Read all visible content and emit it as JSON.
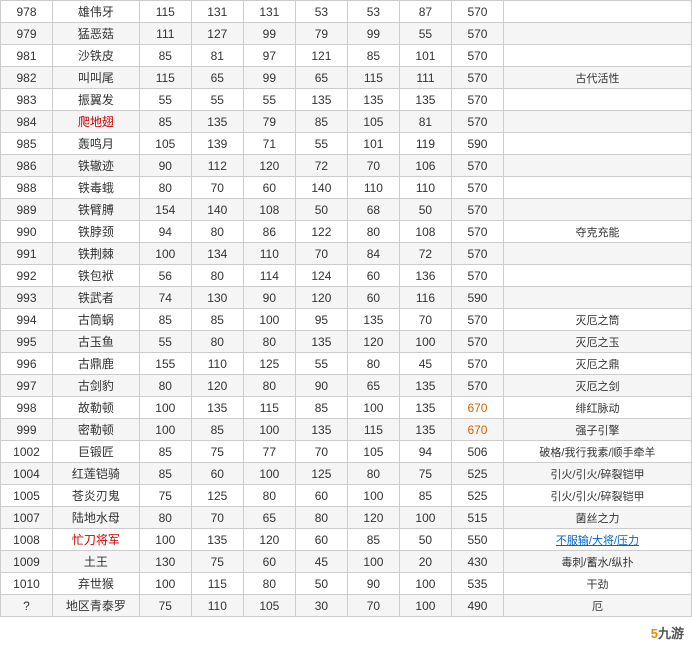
{
  "table": {
    "rows": [
      {
        "id": "978",
        "name": "雄伟牙",
        "s1": 115,
        "s2": 131,
        "s3": 131,
        "s4": 53,
        "s5": 53,
        "s6": 87,
        "total": 570,
        "special": ""
      },
      {
        "id": "979",
        "name": "猛恶菇",
        "s1": 111,
        "s2": 127,
        "s3": 99,
        "s4": 79,
        "s5": 99,
        "s6": 55,
        "total": 570,
        "special": ""
      },
      {
        "id": "981",
        "name": "沙铁皮",
        "s1": 85,
        "s2": 81,
        "s3": 97,
        "s4": 121,
        "s5": 85,
        "s6": 101,
        "total": 570,
        "special": ""
      },
      {
        "id": "982",
        "name": "叫叫尾",
        "s1": 115,
        "s2": 65,
        "s3": 99,
        "s4": 65,
        "s5": 115,
        "s6": 111,
        "total": 570,
        "special": "古代活性"
      },
      {
        "id": "983",
        "name": "振翼发",
        "s1": 55,
        "s2": 55,
        "s3": 55,
        "s4": 135,
        "s5": 135,
        "s6": 135,
        "total": 570,
        "special": ""
      },
      {
        "id": "984",
        "name": "爬地翅",
        "s1": 85,
        "s2": 135,
        "s3": 79,
        "s4": 85,
        "s5": 105,
        "s6": 81,
        "total": 570,
        "special": ""
      },
      {
        "id": "985",
        "name": "轰鸣月",
        "s1": 105,
        "s2": 139,
        "s3": 71,
        "s4": 55,
        "s5": 101,
        "s6": 119,
        "total": 590,
        "special": ""
      },
      {
        "id": "986",
        "name": "铁辙迹",
        "s1": 90,
        "s2": 112,
        "s3": 120,
        "s4": 72,
        "s5": 70,
        "s6": 106,
        "total": 570,
        "special": ""
      },
      {
        "id": "988",
        "name": "铁毒蛾",
        "s1": 80,
        "s2": 70,
        "s3": 60,
        "s4": 140,
        "s5": 110,
        "s6": 110,
        "total": 570,
        "special": ""
      },
      {
        "id": "989",
        "name": "铁臂膊",
        "s1": 154,
        "s2": 140,
        "s3": 108,
        "s4": 50,
        "s5": 68,
        "s6": 50,
        "total": 570,
        "special": ""
      },
      {
        "id": "990",
        "name": "铁脖颈",
        "s1": 94,
        "s2": 80,
        "s3": 86,
        "s4": 122,
        "s5": 80,
        "s6": 108,
        "total": 570,
        "special": "夺克充能"
      },
      {
        "id": "991",
        "name": "铁荆棘",
        "s1": 100,
        "s2": 134,
        "s3": 110,
        "s4": 70,
        "s5": 84,
        "s6": 72,
        "total": 570,
        "special": ""
      },
      {
        "id": "992",
        "name": "铁包袱",
        "s1": 56,
        "s2": 80,
        "s3": 114,
        "s4": 124,
        "s5": 60,
        "s6": 136,
        "total": 570,
        "special": ""
      },
      {
        "id": "993",
        "name": "铁武者",
        "s1": 74,
        "s2": 130,
        "s3": 90,
        "s4": 120,
        "s5": 60,
        "s6": 116,
        "total": 590,
        "special": ""
      },
      {
        "id": "994",
        "name": "古筒蜗",
        "s1": 85,
        "s2": 85,
        "s3": 100,
        "s4": 95,
        "s5": 135,
        "s6": 70,
        "total": 570,
        "special": "灭厄之筒"
      },
      {
        "id": "995",
        "name": "古玉鱼",
        "s1": 55,
        "s2": 80,
        "s3": 80,
        "s4": 135,
        "s5": 120,
        "s6": 100,
        "total": 570,
        "special": "灭厄之玉"
      },
      {
        "id": "996",
        "name": "古鼎鹿",
        "s1": 155,
        "s2": 110,
        "s3": 125,
        "s4": 55,
        "s5": 80,
        "s6": 45,
        "total": 570,
        "special": "灭厄之鼎"
      },
      {
        "id": "997",
        "name": "古剑豹",
        "s1": 80,
        "s2": 120,
        "s3": 80,
        "s4": 90,
        "s5": 65,
        "s6": 135,
        "total": 570,
        "special": "灭厄之剑"
      },
      {
        "id": "998",
        "name": "故勒顿",
        "s1": 100,
        "s2": 135,
        "s3": 115,
        "s4": 85,
        "s5": 100,
        "s6": 135,
        "total": 670,
        "special": "绯红脉动"
      },
      {
        "id": "999",
        "name": "密勒顿",
        "s1": 100,
        "s2": 85,
        "s3": 100,
        "s4": 135,
        "s5": 115,
        "s6": 135,
        "total": 670,
        "special": "强子引擎"
      },
      {
        "id": "1002",
        "name": "巨锻匠",
        "s1": 85,
        "s2": 75,
        "s3": 77,
        "s4": 70,
        "s5": 105,
        "s6": 94,
        "total": 506,
        "special": "破格/我行我素/顺手牵羊"
      },
      {
        "id": "1004",
        "name": "红莲铠骑",
        "s1": 85,
        "s2": 60,
        "s3": 100,
        "s4": 125,
        "s5": 80,
        "s6": 75,
        "total": 525,
        "special": "引火/引火/碎裂铠甲"
      },
      {
        "id": "1005",
        "name": "苍炎刃鬼",
        "s1": 75,
        "s2": 125,
        "s3": 80,
        "s4": 60,
        "s5": 100,
        "s6": 85,
        "total": 525,
        "special": "引火/引火/碎裂铠甲"
      },
      {
        "id": "1007",
        "name": "陆地水母",
        "s1": 80,
        "s2": 70,
        "s3": 65,
        "s4": 80,
        "s5": 120,
        "s6": 100,
        "total": 515,
        "special": "菌丝之力"
      },
      {
        "id": "1008",
        "name": "忙刀将军",
        "s1": 100,
        "s2": 135,
        "s3": 120,
        "s4": 60,
        "s5": 85,
        "s6": 50,
        "total": 550,
        "special": "不服输/大将/压力"
      },
      {
        "id": "1009",
        "name": "土王",
        "s1": 130,
        "s2": 75,
        "s3": 60,
        "s4": 45,
        "s5": 100,
        "s6": 20,
        "total": 430,
        "special": "毒刺/蓄水/纵扑"
      },
      {
        "id": "1010",
        "name": "弃世猴",
        "s1": 100,
        "s2": 115,
        "s3": 80,
        "s4": 50,
        "s5": 90,
        "s6": 100,
        "total": 535,
        "special": "干劲"
      },
      {
        "id": "?",
        "name": "地区青泰罗",
        "s1": 75,
        "s2": 110,
        "s3": 105,
        "s4": 30,
        "s5": 70,
        "s6": 100,
        "total": 490,
        "special": "厄"
      }
    ],
    "special_styles": {
      "古代活性": "normal",
      "夺克充能": "normal",
      "灭厄之筒": "normal",
      "灭厄之玉": "normal",
      "灭厄之鼎": "normal",
      "灭厄之剑": "normal",
      "绯红脉动": "normal",
      "强子引擎": "normal",
      "破格/我行我素/顺手牵羊": "normal",
      "引火/引火/碎裂铠甲": "normal",
      "菌丝之力": "normal",
      "不服输/大将/压力": "link",
      "毒刺/蓄水/纵扑": "normal",
      "干劲": "normal",
      "厄": "normal"
    }
  },
  "watermark": "9游"
}
